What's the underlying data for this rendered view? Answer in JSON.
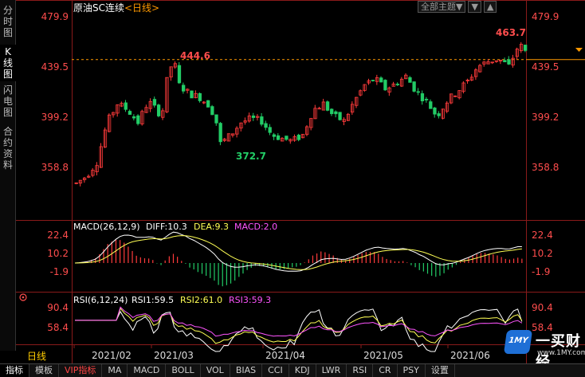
{
  "left_tabs": [
    {
      "label": "分时图",
      "active": false
    },
    {
      "label": "K线图",
      "active": true
    },
    {
      "label": "闪电图",
      "active": false
    },
    {
      "label": "合约资料",
      "active": false
    }
  ],
  "header": {
    "instrument": "原油SC连续",
    "period": "<日线>",
    "theme_button": "全部主题▼",
    "btn_down": "▼",
    "btn_up": "▲"
  },
  "main_price": {
    "y_ticks": [
      "479.9",
      "439.5",
      "399.2",
      "358.8"
    ],
    "last_price_marker": 445.5,
    "high_label": "463.7",
    "peak_label": "444.6",
    "low_label": "372.7"
  },
  "macd": {
    "title": "MACD(26,12,9)",
    "diff": "DIFF:10.3",
    "dea": "DEA:9.3",
    "macd": "MACD:2.0",
    "y_ticks": [
      "22.4",
      "10.2",
      "-1.9"
    ]
  },
  "rsi": {
    "title": "RSI(6,12,24)",
    "rsi1": "RSI1:59.5",
    "rsi2": "RSI2:61.0",
    "rsi3": "RSI3:59.3",
    "y_ticks": [
      "90.4",
      "58.4"
    ]
  },
  "x_axis": {
    "period_label": "日线",
    "dates": [
      "2021/02",
      "2021/03",
      "2021/04",
      "2021/05",
      "2021/06"
    ]
  },
  "bottom_tabs": [
    "指标",
    "模板",
    "VIP指标",
    "MA",
    "MACD",
    "BOLL",
    "VOL",
    "BIAS",
    "CCI",
    "KDJ",
    "LWR",
    "RSI",
    "CR",
    "PSY",
    "设置"
  ],
  "logo": {
    "box": "1MY",
    "name": "一买财经",
    "url": "www.1MY.com"
  },
  "colors": {
    "up": "#ff3b3b",
    "down": "#22cc66",
    "axis_red": "#ff4d4d",
    "grid": "#8a1a1a",
    "diff": "#ffffff",
    "dea": "#ffff55",
    "rsi1": "#ffffff",
    "rsi2": "#ffff55",
    "rsi3": "#ff55ff",
    "orange": "#ff9900"
  }
}
